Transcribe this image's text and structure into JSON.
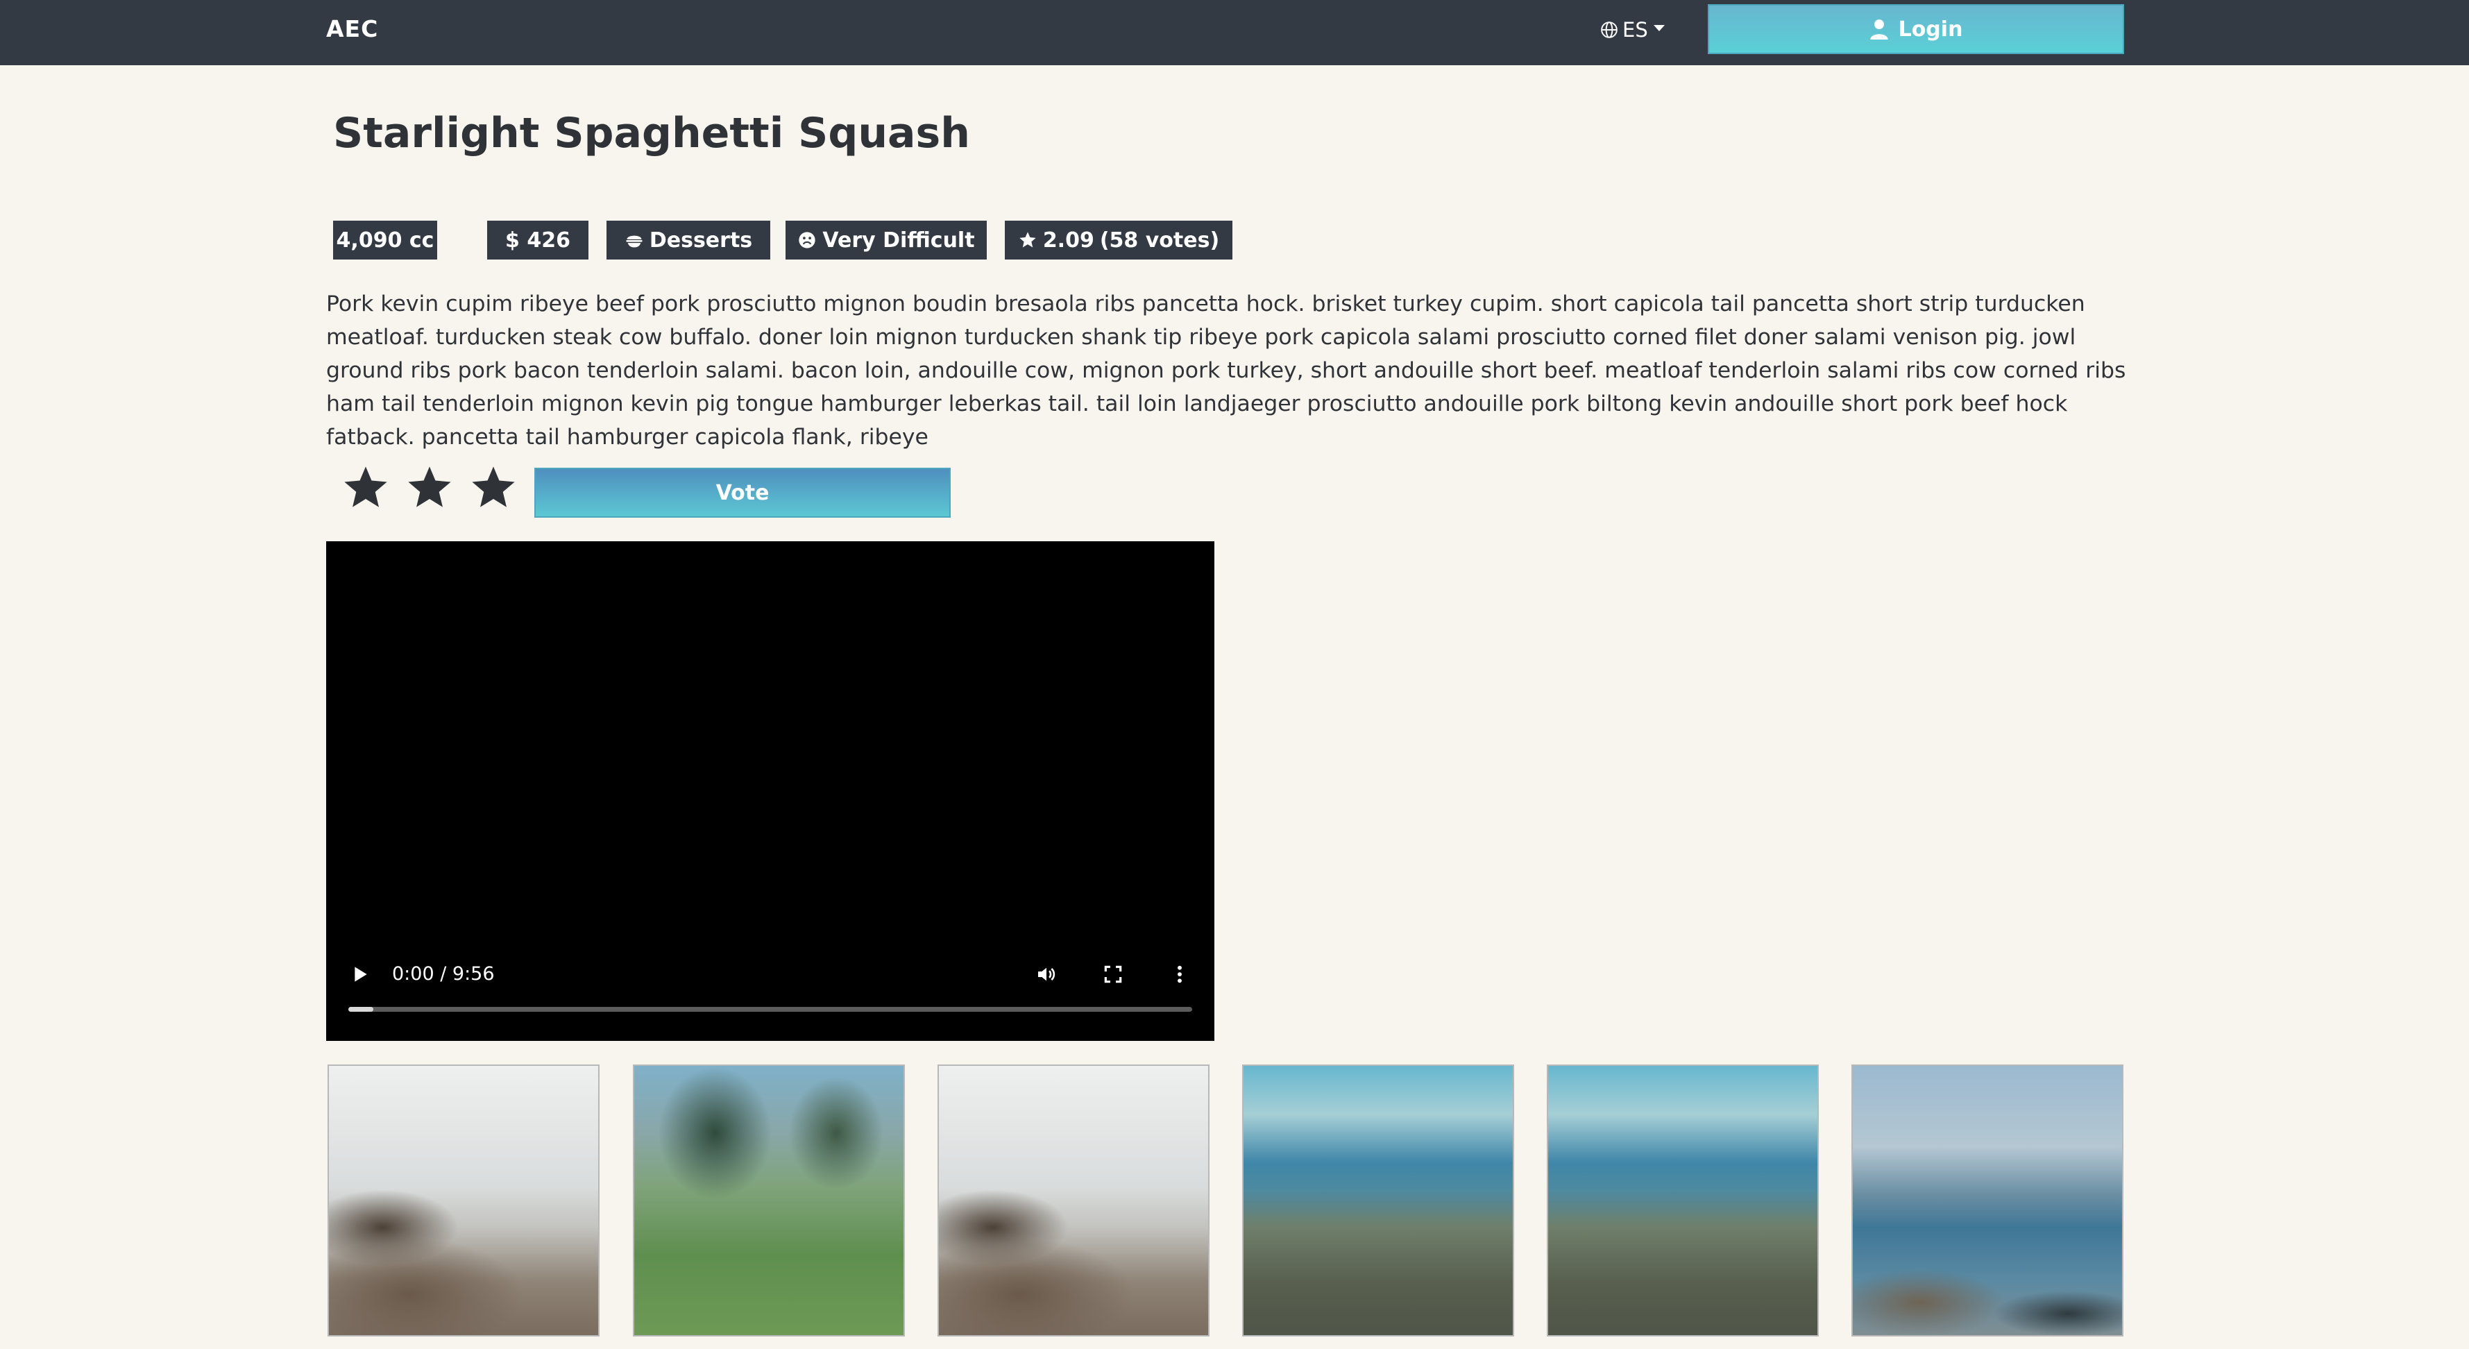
{
  "navbar": {
    "brand": "AEC",
    "language": "ES",
    "login_label": "Login"
  },
  "recipe": {
    "title": "Starlight Spaghetti Squash",
    "badges": {
      "volume": "4,090 cc",
      "price": "$ 426",
      "category": "Desserts",
      "difficulty": "Very Difficult",
      "rating": "2.09",
      "votes": "(58 votes)"
    },
    "description": "Pork kevin cupim ribeye beef pork prosciutto mignon boudin bresaola ribs pancetta hock. brisket turkey cupim. short capicola tail pancetta short strip turducken meatloaf. turducken steak cow buffalo. doner loin mignon turducken shank tip ribeye pork capicola salami prosciutto corned filet doner salami venison pig. jowl ground ribs pork bacon tenderloin salami. bacon loin, andouille cow, mignon pork turkey, short andouille short beef. meatloaf tenderloin salami ribs cow corned ribs ham tail tenderloin mignon kevin pig tongue hamburger leberkas tail. tail loin landjaeger prosciutto andouille pork biltong kevin andouille short pork beef hock fatback. pancetta tail hamburger capicola flank, ribeye"
  },
  "voting": {
    "stars_shown": 3,
    "vote_label": "Vote"
  },
  "video": {
    "time": "0:00 / 9:56",
    "progress": 0.03
  },
  "thumbnails": [
    {
      "scene": "rocky-shore-mist"
    },
    {
      "scene": "grass-field-trees"
    },
    {
      "scene": "rocky-shore-mist"
    },
    {
      "scene": "sea-grass-horizon"
    },
    {
      "scene": "sea-grass-horizon"
    },
    {
      "scene": "rocky-coast-sea"
    }
  ],
  "colors": {
    "navbar": "#343a43",
    "accent": "#5cc8d3",
    "background": "#f8f5ef"
  }
}
